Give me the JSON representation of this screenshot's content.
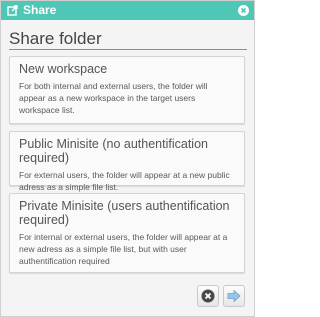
{
  "window": {
    "title": "Share",
    "icons": {
      "title": "share-icon",
      "close": "close-icon"
    },
    "accent_color": "#4fc7b7"
  },
  "heading": "Share folder",
  "options": [
    {
      "title": "New workspace",
      "description": "For both internal and external users, the folder will appear as a new workspace in the target users workspace list."
    },
    {
      "title": "Public Minisite (no authentification required)",
      "description": "For external users, the folder will appear at a new public adress as a simple file list."
    },
    {
      "title": "Private Minisite (users authentification required)",
      "description": "For internal or external users, the folder will appear at a new adress as a simple file list, but with user authentification required"
    }
  ],
  "footer": {
    "cancel_icon": "cancel-icon",
    "next_icon": "next-arrow-icon"
  }
}
